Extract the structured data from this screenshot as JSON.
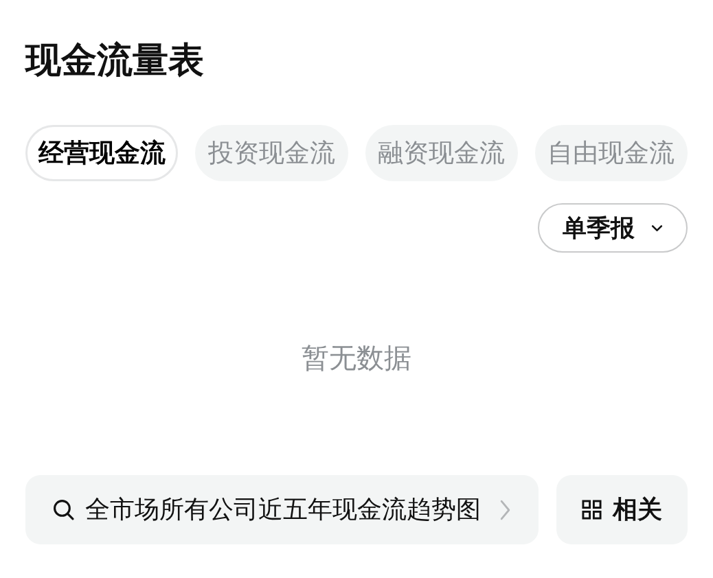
{
  "title": "现金流量表",
  "tabs": [
    {
      "label": "经营现金流",
      "selected": true
    },
    {
      "label": "投资现金流",
      "selected": false
    },
    {
      "label": "融资现金流",
      "selected": false
    },
    {
      "label": "自由现金流",
      "selected": false
    }
  ],
  "period_dropdown": {
    "value": "单季报"
  },
  "empty_state": {
    "text": "暂无数据"
  },
  "footer": {
    "search_link": {
      "text": "全市场所有公司近五年现金流趋势图"
    },
    "related_button": {
      "label": "相关"
    }
  }
}
